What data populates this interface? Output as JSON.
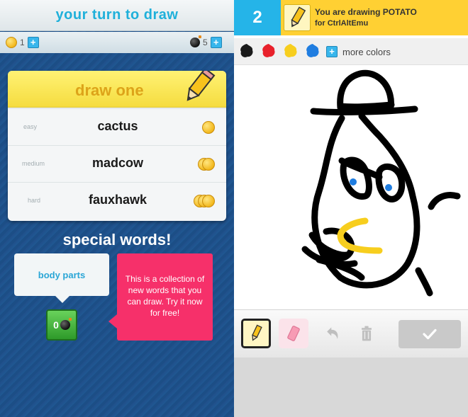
{
  "left": {
    "title": "your turn to draw",
    "coins_count": "1",
    "bombs_count": "5",
    "draw_one_label": "draw one",
    "words": [
      {
        "difficulty": "easy",
        "word": "cactus",
        "coins": 1
      },
      {
        "difficulty": "medium",
        "word": "madcow",
        "coins": 2
      },
      {
        "difficulty": "hard",
        "word": "fauxhawk",
        "coins": 3
      }
    ],
    "special_words_title": "special words!",
    "special_category": "body parts",
    "bomb_button_count": "0",
    "special_description": "This is a collection of new words that you can draw. Try it now for free!"
  },
  "right": {
    "round_number": "2",
    "banner_line1": "You are drawing POTATO",
    "banner_line2": "for CtrlAltEmu",
    "colors": [
      "#1a1a1a",
      "#e8212b",
      "#f7ce1e",
      "#1f7de0"
    ],
    "more_colors_label": "more colors"
  }
}
